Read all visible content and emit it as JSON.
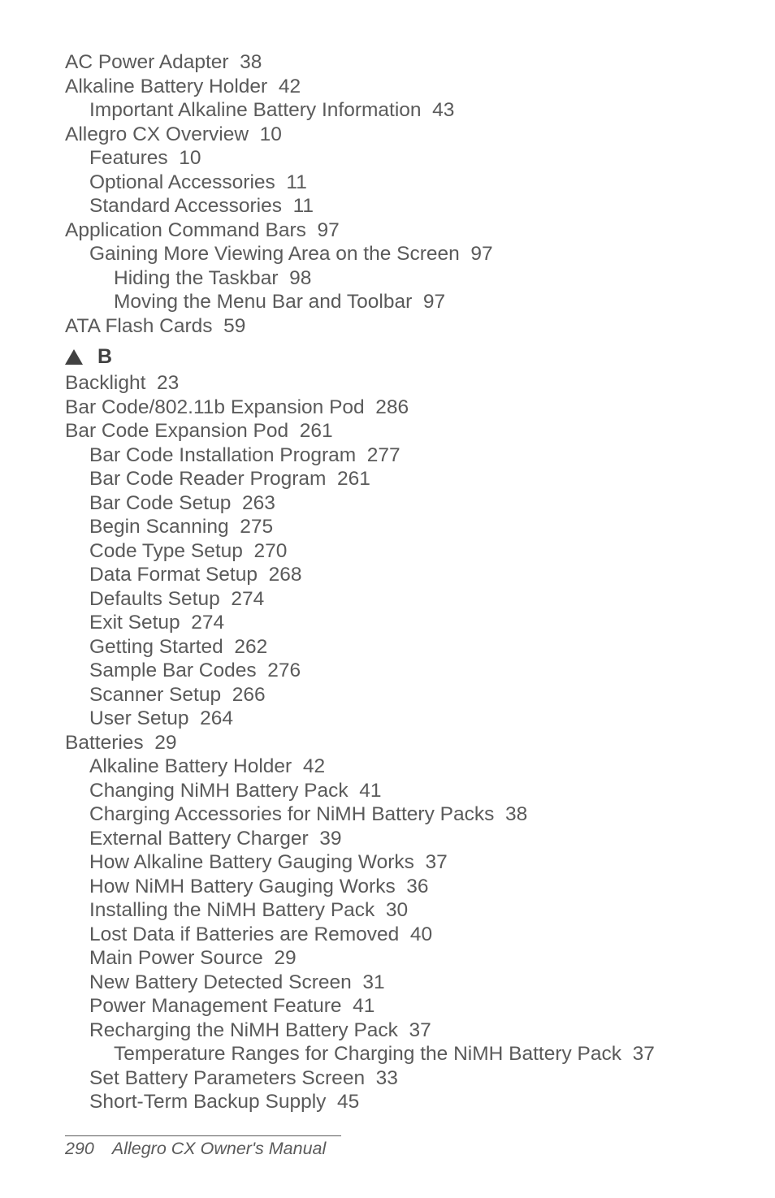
{
  "sections": {
    "A": {
      "entries": [
        {
          "text": "AC Power Adapter  38",
          "level": 0
        },
        {
          "text": "Alkaline Battery Holder  42",
          "level": 0
        },
        {
          "text": "Important Alkaline Battery Information  43",
          "level": 1
        },
        {
          "text": "Allegro CX Overview  10",
          "level": 0
        },
        {
          "text": "Features  10",
          "level": 1
        },
        {
          "text": "Optional Accessories  11",
          "level": 1
        },
        {
          "text": "Standard Accessories  11",
          "level": 1
        },
        {
          "text": "Application Command Bars  97",
          "level": 0
        },
        {
          "text": "Gaining More Viewing Area on the Screen  97",
          "level": 1
        },
        {
          "text": "Hiding the Taskbar  98",
          "level": 2
        },
        {
          "text": "Moving the Menu Bar and Toolbar  97",
          "level": 2
        },
        {
          "text": "ATA Flash Cards  59",
          "level": 0
        }
      ]
    },
    "B": {
      "letter": "B",
      "entries": [
        {
          "text": "Backlight  23",
          "level": 0
        },
        {
          "text": "Bar Code/802.11b Expansion Pod  286",
          "level": 0
        },
        {
          "text": "Bar Code Expansion Pod  261",
          "level": 0
        },
        {
          "text": "Bar Code Installation Program  277",
          "level": 1
        },
        {
          "text": "Bar Code Reader Program  261",
          "level": 1
        },
        {
          "text": "Bar Code Setup  263",
          "level": 1
        },
        {
          "text": "Begin Scanning  275",
          "level": 1
        },
        {
          "text": "Code Type Setup  270",
          "level": 1
        },
        {
          "text": "Data Format Setup  268",
          "level": 1
        },
        {
          "text": "Defaults Setup  274",
          "level": 1
        },
        {
          "text": "Exit Setup  274",
          "level": 1
        },
        {
          "text": "Getting Started  262",
          "level": 1
        },
        {
          "text": "Sample Bar Codes  276",
          "level": 1
        },
        {
          "text": "Scanner Setup  266",
          "level": 1
        },
        {
          "text": "User Setup  264",
          "level": 1
        },
        {
          "text": "Batteries  29",
          "level": 0
        },
        {
          "text": "Alkaline Battery Holder  42",
          "level": 1
        },
        {
          "text": "Changing NiMH Battery Pack  41",
          "level": 1
        },
        {
          "text": "Charging Accessories for NiMH Battery Packs  38",
          "level": 1
        },
        {
          "text": "External Battery Charger  39",
          "level": 1
        },
        {
          "text": "How Alkaline Battery Gauging Works  37",
          "level": 1
        },
        {
          "text": "How NiMH Battery Gauging Works  36",
          "level": 1
        },
        {
          "text": "Installing the NiMH Battery Pack  30",
          "level": 1
        },
        {
          "text": "Lost Data if Batteries are Removed  40",
          "level": 1
        },
        {
          "text": "Main Power Source  29",
          "level": 1
        },
        {
          "text": "New Battery Detected Screen  31",
          "level": 1
        },
        {
          "text": "Power Management Feature  41",
          "level": 1
        },
        {
          "text": "Recharging the NiMH Battery Pack  37",
          "level": 1
        },
        {
          "text": "Temperature Ranges for Charging the NiMH Battery Pack  37",
          "level": 2
        },
        {
          "text": "Set Battery Parameters Screen  33",
          "level": 1
        },
        {
          "text": "Short-Term Backup Supply  45",
          "level": 1
        }
      ]
    }
  },
  "footer": {
    "page": "290",
    "title": "Allegro CX Owner's Manual"
  }
}
